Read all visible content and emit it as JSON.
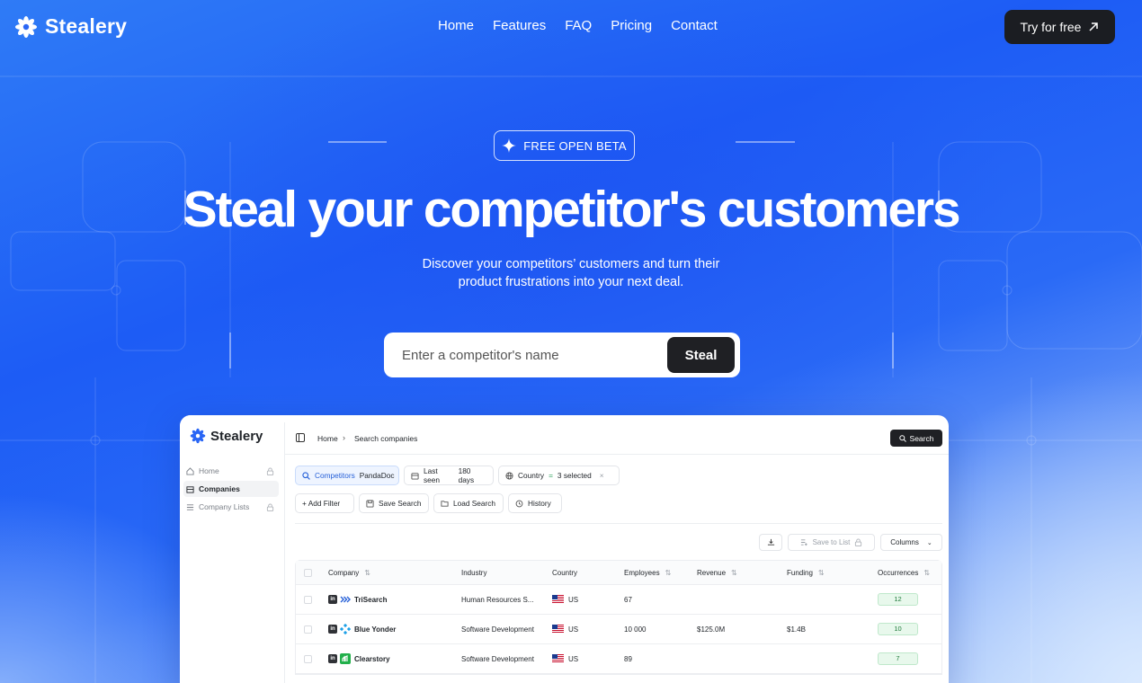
{
  "nav": {
    "brand": "Stealery",
    "links": [
      "Home",
      "Features",
      "FAQ",
      "Pricing",
      "Contact"
    ],
    "cta": "Try for free"
  },
  "hero": {
    "badge": "FREE OPEN BETA",
    "title": "Steal your competitor's customers",
    "subtitle_line1": "Discover your competitors’ customers and turn their",
    "subtitle_line2": "product frustrations into your next deal.",
    "search_placeholder": "Enter a competitor's name",
    "search_button": "Steal"
  },
  "app": {
    "brand": "Stealery",
    "sidebar": [
      {
        "label": "Home",
        "icon": "home-icon",
        "locked": true,
        "active": false
      },
      {
        "label": "Companies",
        "icon": "building-icon",
        "locked": false,
        "active": true
      },
      {
        "label": "Company Lists",
        "icon": "list-icon",
        "locked": true,
        "active": false
      }
    ],
    "breadcrumb": {
      "root": "Home",
      "current": "Search companies"
    },
    "search_button": "Search",
    "filters": {
      "competitors_label": "Competitors",
      "competitors_value": "PandaDoc",
      "last_seen_label": "Last seen",
      "last_seen_value": "180 days",
      "country_label": "Country",
      "country_op": "=",
      "country_value": "3 selected"
    },
    "actions": {
      "add_filter": "+ Add Filter",
      "save_search": "Save Search",
      "load_search": "Load Search",
      "history": "History"
    },
    "table_tools": {
      "save_to_list": "Save to List",
      "columns": "Columns"
    },
    "columns": [
      "Company",
      "Industry",
      "Country",
      "Employees",
      "Revenue",
      "Funding",
      "Occurrences"
    ],
    "rows": [
      {
        "company": "TriSearch",
        "industry": "Human Resources S...",
        "country": "US",
        "employees": "67",
        "revenue": "",
        "funding": "",
        "occurrences": "12"
      },
      {
        "company": "Blue Yonder",
        "industry": "Software Development",
        "country": "US",
        "employees": "10 000",
        "revenue": "$125.0M",
        "funding": "$1.4B",
        "occurrences": "10"
      },
      {
        "company": "Clearstory",
        "industry": "Software Development",
        "country": "US",
        "employees": "89",
        "revenue": "",
        "funding": "",
        "occurrences": "7"
      }
    ]
  },
  "colors": {
    "brand_blue": "#1d5cf5",
    "dark_button": "#1b1d22",
    "occurrence_green": "#e8f8ec"
  }
}
